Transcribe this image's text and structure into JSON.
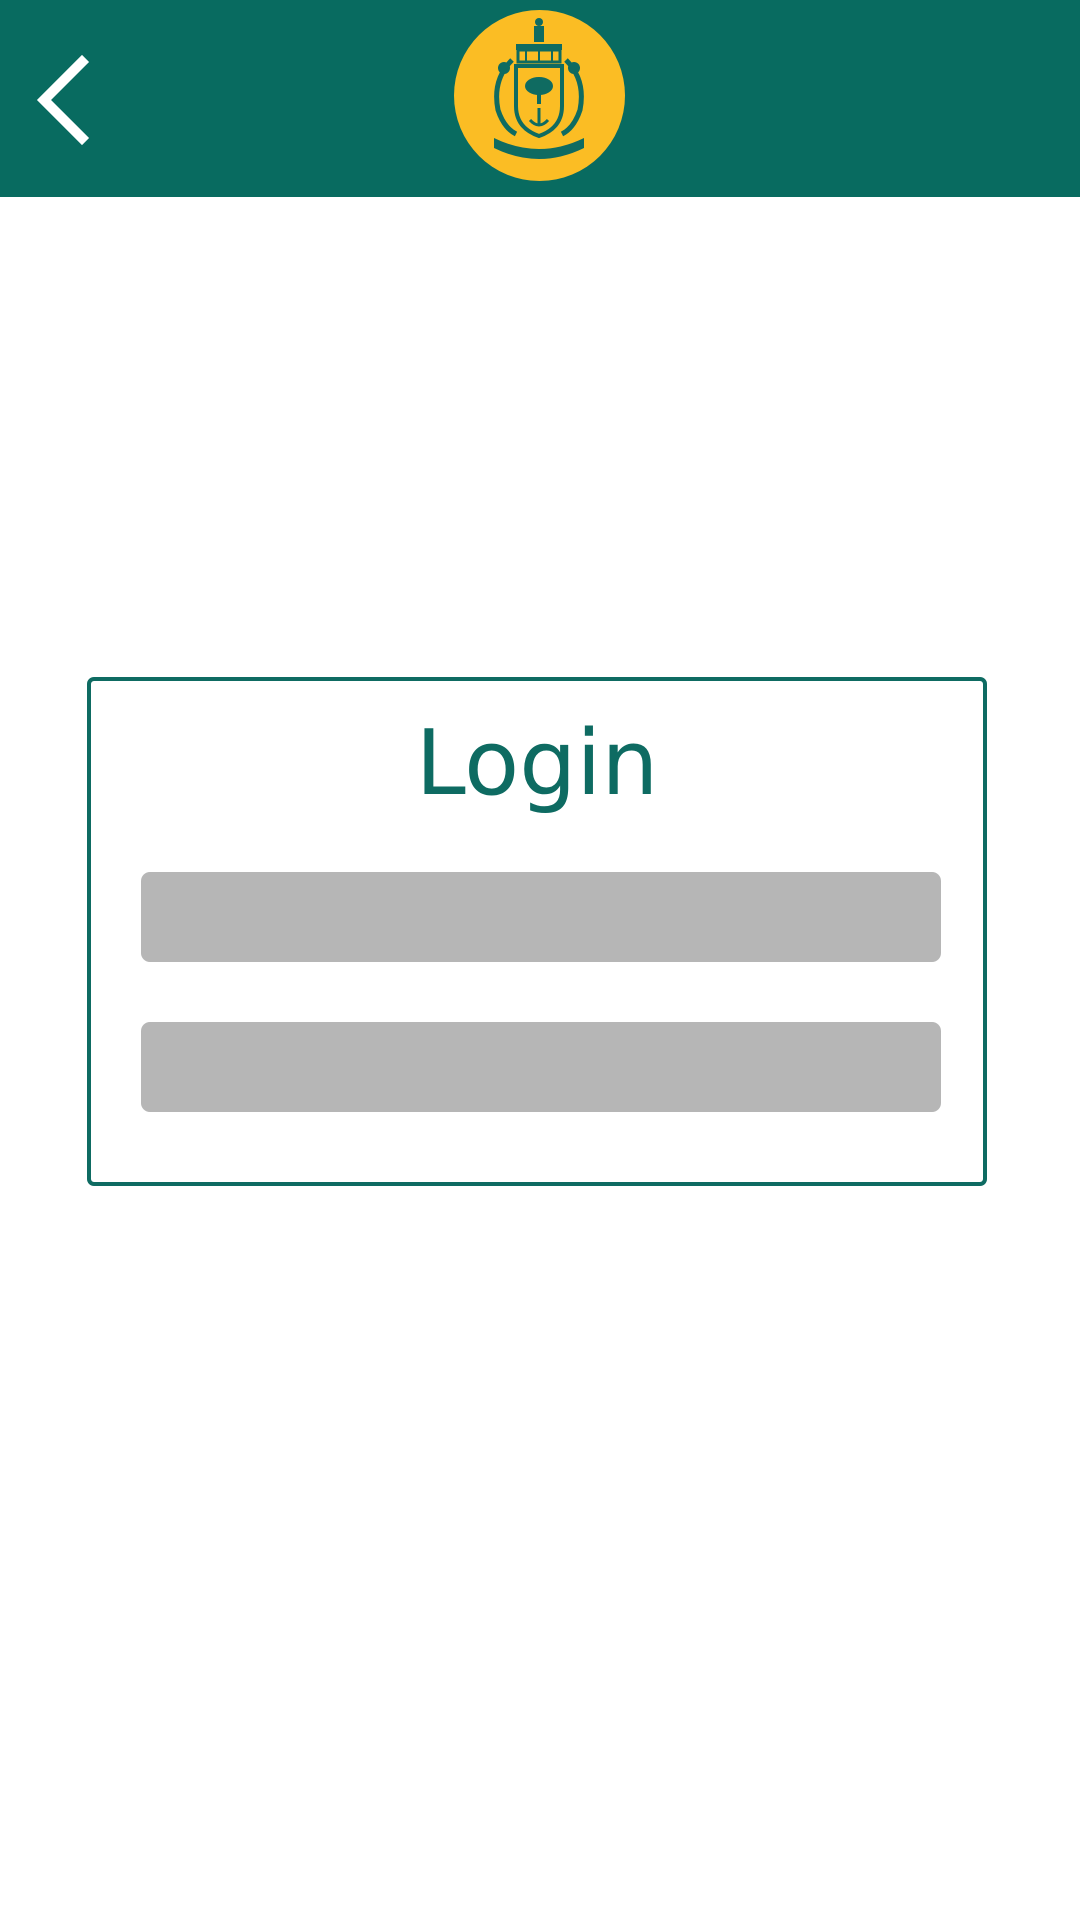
{
  "header": {
    "background_color": "#086b60",
    "back_icon": "chevron-left-icon",
    "logo": {
      "description_icon": "city-coat-of-arms-logo",
      "background_color": "#fbbd24"
    }
  },
  "login_card": {
    "title": "Login",
    "accent_color": "#0e6b62",
    "username_field": {
      "value": "",
      "placeholder": ""
    },
    "password_field": {
      "value": "",
      "placeholder": ""
    }
  }
}
